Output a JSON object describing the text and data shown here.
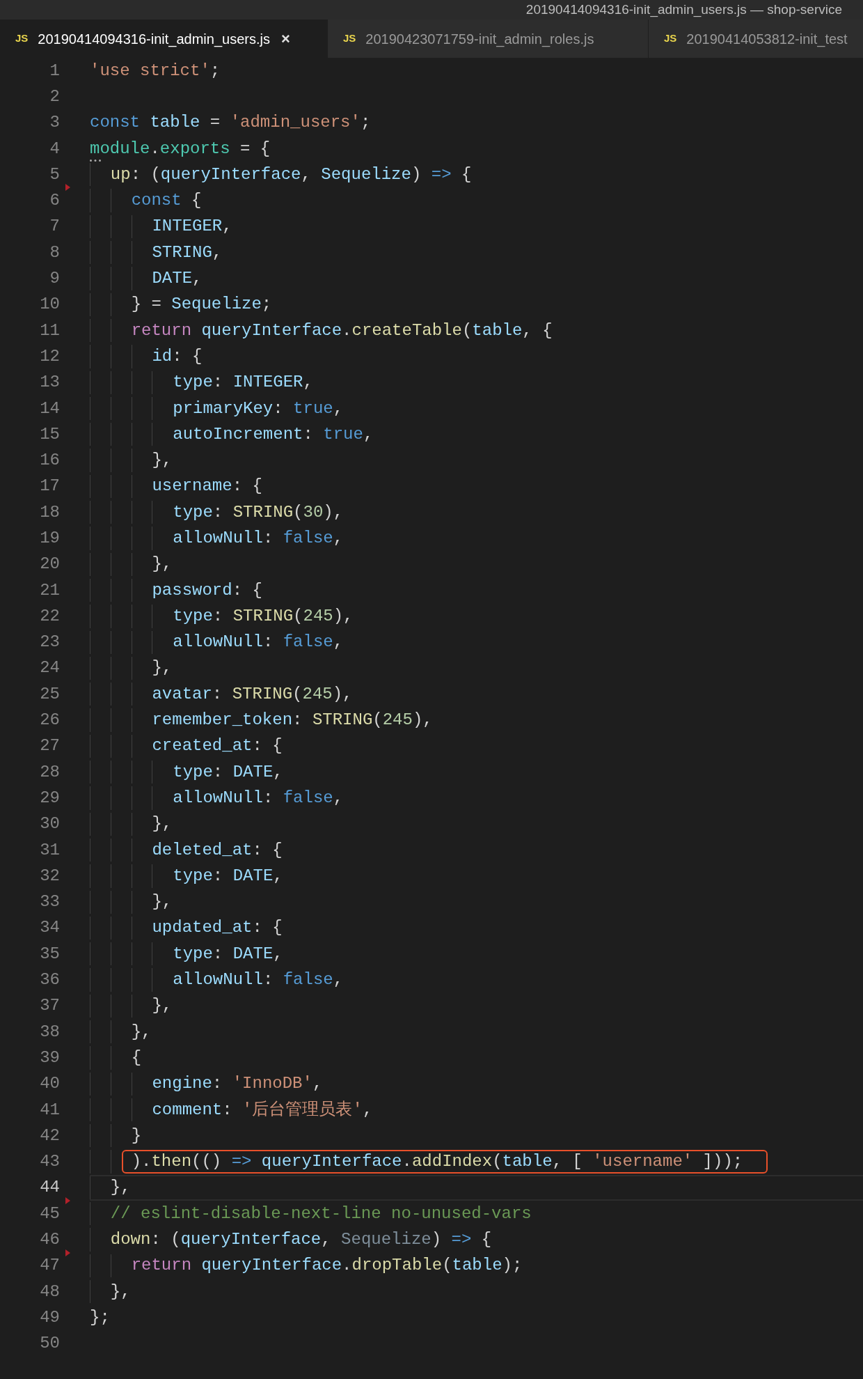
{
  "window": {
    "title": "20190414094316-init_admin_users.js — shop-service"
  },
  "tabs": [
    {
      "icon": "JS",
      "label": "20190414094316-init_admin_users.js",
      "close": "×",
      "selected": true
    },
    {
      "icon": "JS",
      "label": "20190423071759-init_admin_roles.js",
      "selected": false
    },
    {
      "icon": "JS",
      "label": "20190414053812-init_test",
      "selected": false
    }
  ],
  "lines": [
    {
      "number": "1",
      "current": false,
      "boxed": false,
      "deleted_above": false,
      "tokens": [
        {
          "kind": "str",
          "text": "'use strict'"
        },
        {
          "kind": "plain",
          "text": ";"
        }
      ]
    },
    {
      "number": "2",
      "current": false,
      "boxed": false,
      "deleted_above": false
    },
    {
      "number": "3",
      "current": false,
      "boxed": false,
      "deleted_above": false,
      "tokens": [
        {
          "kind": "kw",
          "text": "const"
        },
        {
          "kind": "var",
          "text": " table"
        },
        {
          "kind": "plain",
          "text": " = "
        },
        {
          "kind": "str",
          "text": "'admin_users'"
        },
        {
          "kind": "plain",
          "text": ";"
        }
      ]
    },
    {
      "number": "4",
      "current": false,
      "boxed": false,
      "deleted_above": false,
      "tokens": [
        {
          "kind": "mod",
          "text": "module"
        },
        {
          "kind": "plain",
          "text": "."
        },
        {
          "kind": "mod",
          "text": "exports"
        },
        {
          "kind": "plain",
          "text": " = {"
        }
      ]
    },
    {
      "number": "5",
      "current": false,
      "boxed": false,
      "deleted_above": false,
      "tokens": [
        {
          "kind": "fn",
          "text": "  up"
        },
        {
          "kind": "plain",
          "text": ": ("
        },
        {
          "kind": "var",
          "text": "queryInterface"
        },
        {
          "kind": "plain",
          "text": ", "
        },
        {
          "kind": "var",
          "text": "Sequelize"
        },
        {
          "kind": "plain",
          "text": ") "
        },
        {
          "kind": "kw",
          "text": "=>"
        },
        {
          "kind": "plain",
          "text": " {"
        }
      ]
    },
    {
      "number": "6",
      "current": false,
      "boxed": false,
      "deleted_above": true,
      "tokens": [
        {
          "kind": "kw",
          "text": "    const"
        },
        {
          "kind": "plain",
          "text": " {"
        }
      ]
    },
    {
      "number": "7",
      "current": false,
      "boxed": false,
      "deleted_above": false,
      "tokens": [
        {
          "kind": "var",
          "text": "      INTEGER"
        },
        {
          "kind": "plain",
          "text": ","
        }
      ]
    },
    {
      "number": "8",
      "current": false,
      "boxed": false,
      "deleted_above": false,
      "tokens": [
        {
          "kind": "var",
          "text": "      STRING"
        },
        {
          "kind": "plain",
          "text": ","
        }
      ]
    },
    {
      "number": "9",
      "current": false,
      "boxed": false,
      "deleted_above": false,
      "tokens": [
        {
          "kind": "var",
          "text": "      DATE"
        },
        {
          "kind": "plain",
          "text": ","
        }
      ]
    },
    {
      "number": "10",
      "current": false,
      "boxed": false,
      "deleted_above": false,
      "tokens": [
        {
          "kind": "plain",
          "text": "    } = "
        },
        {
          "kind": "var",
          "text": "Sequelize"
        },
        {
          "kind": "plain",
          "text": ";"
        }
      ]
    },
    {
      "number": "11",
      "current": false,
      "boxed": false,
      "deleted_above": false,
      "tokens": [
        {
          "kind": "ctl",
          "text": "    return"
        },
        {
          "kind": "var",
          "text": " queryInterface"
        },
        {
          "kind": "plain",
          "text": "."
        },
        {
          "kind": "fn",
          "text": "createTable"
        },
        {
          "kind": "plain",
          "text": "("
        },
        {
          "kind": "var",
          "text": "table"
        },
        {
          "kind": "plain",
          "text": ", {"
        }
      ]
    },
    {
      "number": "12",
      "current": false,
      "boxed": false,
      "deleted_above": false,
      "tokens": [
        {
          "kind": "var",
          "text": "      id"
        },
        {
          "kind": "plain",
          "text": ": {"
        }
      ]
    },
    {
      "number": "13",
      "current": false,
      "boxed": false,
      "deleted_above": false,
      "tokens": [
        {
          "kind": "var",
          "text": "        type"
        },
        {
          "kind": "plain",
          "text": ": "
        },
        {
          "kind": "var",
          "text": "INTEGER"
        },
        {
          "kind": "plain",
          "text": ","
        }
      ]
    },
    {
      "number": "14",
      "current": false,
      "boxed": false,
      "deleted_above": false,
      "tokens": [
        {
          "kind": "var",
          "text": "        primaryKey"
        },
        {
          "kind": "plain",
          "text": ": "
        },
        {
          "kind": "kw",
          "text": "true"
        },
        {
          "kind": "plain",
          "text": ","
        }
      ]
    },
    {
      "number": "15",
      "current": false,
      "boxed": false,
      "deleted_above": false,
      "tokens": [
        {
          "kind": "var",
          "text": "        autoIncrement"
        },
        {
          "kind": "plain",
          "text": ": "
        },
        {
          "kind": "kw",
          "text": "true"
        },
        {
          "kind": "plain",
          "text": ","
        }
      ]
    },
    {
      "number": "16",
      "current": false,
      "boxed": false,
      "deleted_above": false,
      "tokens": [
        {
          "kind": "plain",
          "text": "      },"
        }
      ]
    },
    {
      "number": "17",
      "current": false,
      "boxed": false,
      "deleted_above": false,
      "tokens": [
        {
          "kind": "var",
          "text": "      username"
        },
        {
          "kind": "plain",
          "text": ": {"
        }
      ]
    },
    {
      "number": "18",
      "current": false,
      "boxed": false,
      "deleted_above": false,
      "tokens": [
        {
          "kind": "var",
          "text": "        type"
        },
        {
          "kind": "plain",
          "text": ": "
        },
        {
          "kind": "fn",
          "text": "STRING"
        },
        {
          "kind": "plain",
          "text": "("
        },
        {
          "kind": "num",
          "text": "30"
        },
        {
          "kind": "plain",
          "text": "),"
        }
      ]
    },
    {
      "number": "19",
      "current": false,
      "boxed": false,
      "deleted_above": false,
      "tokens": [
        {
          "kind": "var",
          "text": "        allowNull"
        },
        {
          "kind": "plain",
          "text": ": "
        },
        {
          "kind": "kw",
          "text": "false"
        },
        {
          "kind": "plain",
          "text": ","
        }
      ]
    },
    {
      "number": "20",
      "current": false,
      "boxed": false,
      "deleted_above": false,
      "tokens": [
        {
          "kind": "plain",
          "text": "      },"
        }
      ]
    },
    {
      "number": "21",
      "current": false,
      "boxed": false,
      "deleted_above": false,
      "tokens": [
        {
          "kind": "var",
          "text": "      password"
        },
        {
          "kind": "plain",
          "text": ": {"
        }
      ]
    },
    {
      "number": "22",
      "current": false,
      "boxed": false,
      "deleted_above": false,
      "tokens": [
        {
          "kind": "var",
          "text": "        type"
        },
        {
          "kind": "plain",
          "text": ": "
        },
        {
          "kind": "fn",
          "text": "STRING"
        },
        {
          "kind": "plain",
          "text": "("
        },
        {
          "kind": "num",
          "text": "245"
        },
        {
          "kind": "plain",
          "text": "),"
        }
      ]
    },
    {
      "number": "23",
      "current": false,
      "boxed": false,
      "deleted_above": false,
      "tokens": [
        {
          "kind": "var",
          "text": "        allowNull"
        },
        {
          "kind": "plain",
          "text": ": "
        },
        {
          "kind": "kw",
          "text": "false"
        },
        {
          "kind": "plain",
          "text": ","
        }
      ]
    },
    {
      "number": "24",
      "current": false,
      "boxed": false,
      "deleted_above": false,
      "tokens": [
        {
          "kind": "plain",
          "text": "      },"
        }
      ]
    },
    {
      "number": "25",
      "current": false,
      "boxed": false,
      "deleted_above": false,
      "tokens": [
        {
          "kind": "var",
          "text": "      avatar"
        },
        {
          "kind": "plain",
          "text": ": "
        },
        {
          "kind": "fn",
          "text": "STRING"
        },
        {
          "kind": "plain",
          "text": "("
        },
        {
          "kind": "num",
          "text": "245"
        },
        {
          "kind": "plain",
          "text": "),"
        }
      ]
    },
    {
      "number": "26",
      "current": false,
      "boxed": false,
      "deleted_above": false,
      "tokens": [
        {
          "kind": "var",
          "text": "      remember_token"
        },
        {
          "kind": "plain",
          "text": ": "
        },
        {
          "kind": "fn",
          "text": "STRING"
        },
        {
          "kind": "plain",
          "text": "("
        },
        {
          "kind": "num",
          "text": "245"
        },
        {
          "kind": "plain",
          "text": "),"
        }
      ]
    },
    {
      "number": "27",
      "current": false,
      "boxed": false,
      "deleted_above": false,
      "tokens": [
        {
          "kind": "var",
          "text": "      created_at"
        },
        {
          "kind": "plain",
          "text": ": {"
        }
      ]
    },
    {
      "number": "28",
      "current": false,
      "boxed": false,
      "deleted_above": false,
      "tokens": [
        {
          "kind": "var",
          "text": "        type"
        },
        {
          "kind": "plain",
          "text": ": "
        },
        {
          "kind": "var",
          "text": "DATE"
        },
        {
          "kind": "plain",
          "text": ","
        }
      ]
    },
    {
      "number": "29",
      "current": false,
      "boxed": false,
      "deleted_above": false,
      "tokens": [
        {
          "kind": "var",
          "text": "        allowNull"
        },
        {
          "kind": "plain",
          "text": ": "
        },
        {
          "kind": "kw",
          "text": "false"
        },
        {
          "kind": "plain",
          "text": ","
        }
      ]
    },
    {
      "number": "30",
      "current": false,
      "boxed": false,
      "deleted_above": false,
      "tokens": [
        {
          "kind": "plain",
          "text": "      },"
        }
      ]
    },
    {
      "number": "31",
      "current": false,
      "boxed": false,
      "deleted_above": false,
      "tokens": [
        {
          "kind": "var",
          "text": "      deleted_at"
        },
        {
          "kind": "plain",
          "text": ": {"
        }
      ]
    },
    {
      "number": "32",
      "current": false,
      "boxed": false,
      "deleted_above": false,
      "tokens": [
        {
          "kind": "var",
          "text": "        type"
        },
        {
          "kind": "plain",
          "text": ": "
        },
        {
          "kind": "var",
          "text": "DATE"
        },
        {
          "kind": "plain",
          "text": ","
        }
      ]
    },
    {
      "number": "33",
      "current": false,
      "boxed": false,
      "deleted_above": false,
      "tokens": [
        {
          "kind": "plain",
          "text": "      },"
        }
      ]
    },
    {
      "number": "34",
      "current": false,
      "boxed": false,
      "deleted_above": false,
      "tokens": [
        {
          "kind": "var",
          "text": "      updated_at"
        },
        {
          "kind": "plain",
          "text": ": {"
        }
      ]
    },
    {
      "number": "35",
      "current": false,
      "boxed": false,
      "deleted_above": false,
      "tokens": [
        {
          "kind": "var",
          "text": "        type"
        },
        {
          "kind": "plain",
          "text": ": "
        },
        {
          "kind": "var",
          "text": "DATE"
        },
        {
          "kind": "plain",
          "text": ","
        }
      ]
    },
    {
      "number": "36",
      "current": false,
      "boxed": false,
      "deleted_above": false,
      "tokens": [
        {
          "kind": "var",
          "text": "        allowNull"
        },
        {
          "kind": "plain",
          "text": ": "
        },
        {
          "kind": "kw",
          "text": "false"
        },
        {
          "kind": "plain",
          "text": ","
        }
      ]
    },
    {
      "number": "37",
      "current": false,
      "boxed": false,
      "deleted_above": false,
      "tokens": [
        {
          "kind": "plain",
          "text": "      },"
        }
      ]
    },
    {
      "number": "38",
      "current": false,
      "boxed": false,
      "deleted_above": false,
      "tokens": [
        {
          "kind": "plain",
          "text": "    },"
        }
      ]
    },
    {
      "number": "39",
      "current": false,
      "boxed": false,
      "deleted_above": false,
      "tokens": [
        {
          "kind": "plain",
          "text": "    {"
        }
      ]
    },
    {
      "number": "40",
      "current": false,
      "boxed": false,
      "deleted_above": false,
      "tokens": [
        {
          "kind": "var",
          "text": "      engine"
        },
        {
          "kind": "plain",
          "text": ": "
        },
        {
          "kind": "str",
          "text": "'InnoDB'"
        },
        {
          "kind": "plain",
          "text": ","
        }
      ]
    },
    {
      "number": "41",
      "current": false,
      "boxed": false,
      "deleted_above": false,
      "tokens": [
        {
          "kind": "var",
          "text": "      comment"
        },
        {
          "kind": "plain",
          "text": ": "
        },
        {
          "kind": "str",
          "text": "'后台管理员表'"
        },
        {
          "kind": "plain",
          "text": ","
        }
      ]
    },
    {
      "number": "42",
      "current": false,
      "boxed": false,
      "deleted_above": false,
      "tokens": [
        {
          "kind": "plain",
          "text": "    }"
        }
      ]
    },
    {
      "number": "43",
      "current": false,
      "boxed": true,
      "deleted_above": false,
      "tokens": [
        {
          "kind": "plain",
          "text": "    )."
        },
        {
          "kind": "fn",
          "text": "then"
        },
        {
          "kind": "plain",
          "text": "(() "
        },
        {
          "kind": "kw",
          "text": "=>"
        },
        {
          "kind": "var",
          "text": " queryInterface"
        },
        {
          "kind": "plain",
          "text": "."
        },
        {
          "kind": "fn",
          "text": "addIndex"
        },
        {
          "kind": "plain",
          "text": "("
        },
        {
          "kind": "var",
          "text": "table"
        },
        {
          "kind": "plain",
          "text": ", [ "
        },
        {
          "kind": "str",
          "text": "'username'"
        },
        {
          "kind": "plain",
          "text": " ]));"
        }
      ]
    },
    {
      "number": "44",
      "current": true,
      "boxed": false,
      "deleted_above": false,
      "tokens": [
        {
          "kind": "plain",
          "text": "  },"
        }
      ]
    },
    {
      "number": "45",
      "current": false,
      "boxed": false,
      "deleted_above": true,
      "tokens": [
        {
          "kind": "cmt",
          "text": "  // eslint-disable-next-line no-unused-vars"
        }
      ]
    },
    {
      "number": "46",
      "current": false,
      "boxed": false,
      "deleted_above": false,
      "tokens": [
        {
          "kind": "fn",
          "text": "  down"
        },
        {
          "kind": "plain",
          "text": ": ("
        },
        {
          "kind": "var",
          "text": "queryInterface"
        },
        {
          "kind": "plain",
          "text": ", "
        },
        {
          "kind": "dim",
          "text": "Sequelize"
        },
        {
          "kind": "plain",
          "text": ") "
        },
        {
          "kind": "kw",
          "text": "=>"
        },
        {
          "kind": "plain",
          "text": " {"
        }
      ]
    },
    {
      "number": "47",
      "current": false,
      "boxed": false,
      "deleted_above": true,
      "tokens": [
        {
          "kind": "ctl",
          "text": "    return"
        },
        {
          "kind": "var",
          "text": " queryInterface"
        },
        {
          "kind": "plain",
          "text": "."
        },
        {
          "kind": "fn",
          "text": "dropTable"
        },
        {
          "kind": "plain",
          "text": "("
        },
        {
          "kind": "var",
          "text": "table"
        },
        {
          "kind": "plain",
          "text": ");"
        }
      ]
    },
    {
      "number": "48",
      "current": false,
      "boxed": false,
      "deleted_above": false,
      "tokens": [
        {
          "kind": "plain",
          "text": "  },"
        }
      ]
    },
    {
      "number": "49",
      "current": false,
      "boxed": false,
      "deleted_above": false,
      "tokens": [
        {
          "kind": "plain",
          "text": "};"
        }
      ]
    },
    {
      "number": "50",
      "current": false,
      "boxed": false,
      "deleted_above": false
    }
  ]
}
